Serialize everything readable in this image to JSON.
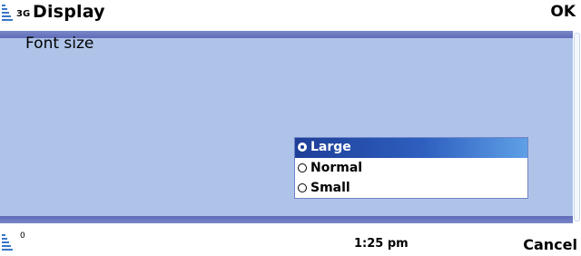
{
  "statusbar": {
    "network": "3G",
    "title": "Display",
    "right_softkey": "OK"
  },
  "main": {
    "setting_label": "Font size"
  },
  "popup": {
    "options": [
      {
        "label": "Large",
        "selected": true
      },
      {
        "label": "Normal",
        "selected": false
      },
      {
        "label": "Small",
        "selected": false
      }
    ]
  },
  "bottombar": {
    "indicator": "0",
    "clock": "1:25 pm",
    "left_softkey": "Cancel"
  },
  "colors": {
    "panel_bg": "#aec3e8",
    "panel_border": "#6a77c0",
    "selection": "#1e3f98",
    "accent": "#3a76c8"
  },
  "icons": {
    "signal": "signal-strength-icon",
    "battery": "battery-icon",
    "radio_on": "radio-selected-icon",
    "radio_off": "radio-unselected-icon"
  }
}
